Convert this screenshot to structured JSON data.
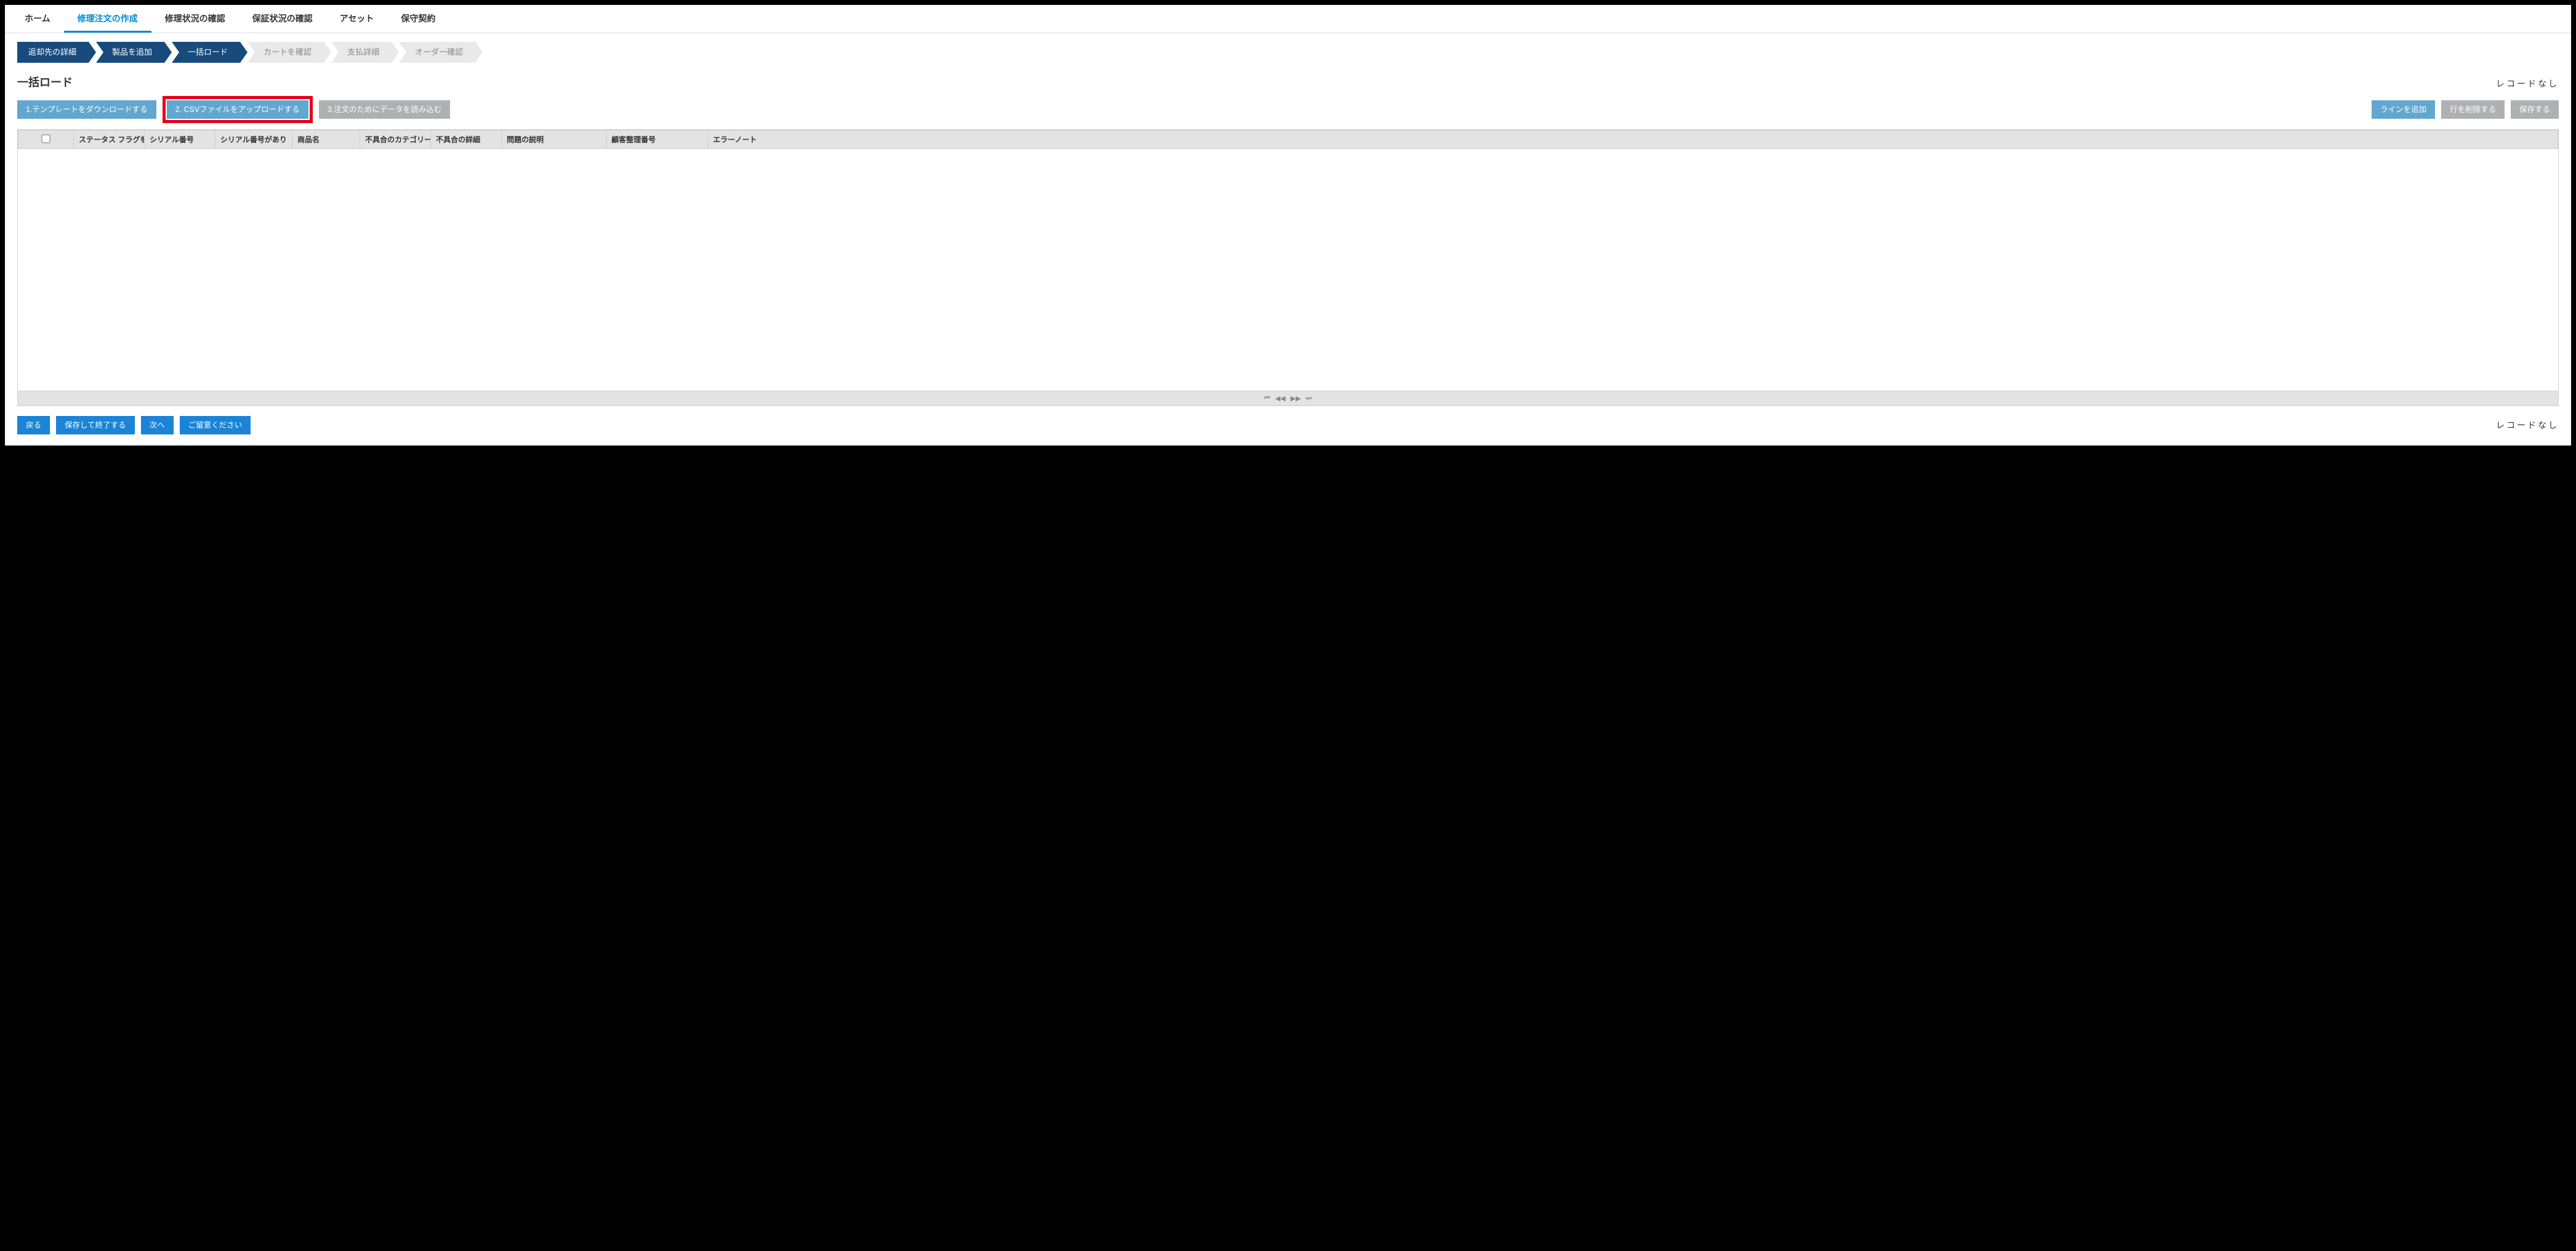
{
  "nav": {
    "home": "ホーム",
    "create": "修理注文の作成",
    "repair_status": "修理状況の確認",
    "warranty_status": "保証状況の確認",
    "asset": "アセット",
    "contract": "保守契約"
  },
  "steps": {
    "return_detail": "返却先の詳細",
    "add_product": "製品を追加",
    "bulk_load": "一括ロード",
    "check_cart": "カートを確認",
    "payment": "支払詳細",
    "confirm_order": "オーダー確認"
  },
  "section": {
    "title": "一括ロード",
    "record_count": "レコードなし"
  },
  "buttons": {
    "download_template": "1.テンプレートをダウンロードする",
    "upload_csv": "2. CSVファイルをアップロードする",
    "import_data": "3.注文のためにデータを読み込む",
    "add_line": "ラインを追加",
    "delete_row": "行を削除する",
    "save": "保存する",
    "back": "戻る",
    "save_exit": "保存して終了する",
    "next": "次へ",
    "hold": "ご留意ください"
  },
  "table": {
    "col_status_flag": "ステータス フラグを",
    "col_serial": "シリアル番号",
    "col_serial_exist": "シリアル番号があり",
    "col_product": "商品名",
    "col_fault_category": "不具合のカテゴリー",
    "col_fault_detail": "不具合の詳細",
    "col_issue_desc": "問題の説明",
    "col_customer_ref": "顧客整理番号",
    "col_error_note": "エラーノート"
  }
}
